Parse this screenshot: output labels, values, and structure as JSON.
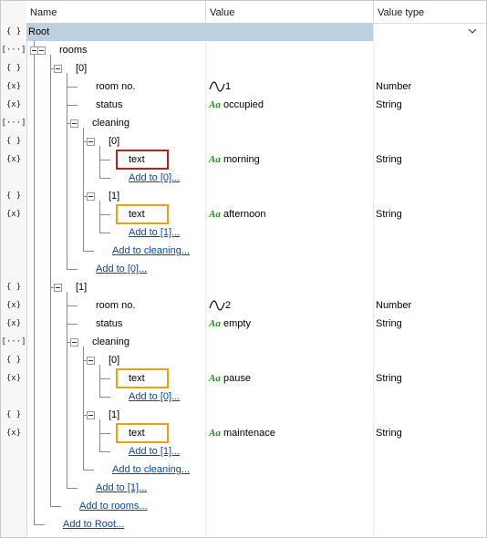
{
  "header": {
    "name": "Name",
    "value": "Value",
    "value_type": "Value type"
  },
  "colors": {
    "selected_row": "#bdd0e0",
    "highlight_red": "#b22222",
    "highlight_orange": "#f0a000",
    "link": "#0645ad",
    "string_icon": "#1a9a1a"
  },
  "rows": [
    {
      "icon": "{ }",
      "name": "Root",
      "value": "",
      "value_type": "",
      "selected": true
    },
    {
      "icon": "[···]",
      "name": "rooms",
      "value": "",
      "value_type": ""
    },
    {
      "icon": "{ }",
      "name": "[0]",
      "value": "",
      "value_type": ""
    },
    {
      "icon": "{x}",
      "name": "room no.",
      "value": "1",
      "value_icon": "number-wave-icon",
      "value_type": "Number"
    },
    {
      "icon": "{x}",
      "name": "status",
      "value": "occupied",
      "value_icon": "string-aa-icon",
      "value_type": "String"
    },
    {
      "icon": "[···]",
      "name": "cleaning",
      "value": "",
      "value_type": ""
    },
    {
      "icon": "{ }",
      "name": "[0]",
      "value": "",
      "value_type": ""
    },
    {
      "icon": "{x}",
      "name": "text",
      "value": "morning",
      "value_icon": "string-aa-icon",
      "value_type": "String"
    },
    {
      "icon": "",
      "name": "Add to [0]...",
      "value": "",
      "value_type": "",
      "link": true
    },
    {
      "icon": "{ }",
      "name": "[1]",
      "value": "",
      "value_type": ""
    },
    {
      "icon": "{x}",
      "name": "text",
      "value": "afternoon",
      "value_icon": "string-aa-icon",
      "value_type": "String"
    },
    {
      "icon": "",
      "name": "Add to [1]...",
      "value": "",
      "value_type": "",
      "link": true
    },
    {
      "icon": "",
      "name": "Add to cleaning...",
      "value": "",
      "value_type": "",
      "link": true
    },
    {
      "icon": "",
      "name": "Add to [0]...",
      "value": "",
      "value_type": "",
      "link": true
    },
    {
      "icon": "{ }",
      "name": "[1]",
      "value": "",
      "value_type": ""
    },
    {
      "icon": "{x}",
      "name": "room no.",
      "value": "2",
      "value_icon": "number-wave-icon",
      "value_type": "Number"
    },
    {
      "icon": "{x}",
      "name": "status",
      "value": "empty",
      "value_icon": "string-aa-icon",
      "value_type": "String"
    },
    {
      "icon": "[···]",
      "name": "cleaning",
      "value": "",
      "value_type": ""
    },
    {
      "icon": "{ }",
      "name": "[0]",
      "value": "",
      "value_type": ""
    },
    {
      "icon": "{x}",
      "name": "text",
      "value": "pause",
      "value_icon": "string-aa-icon",
      "value_type": "String"
    },
    {
      "icon": "",
      "name": "Add to [0]...",
      "value": "",
      "value_type": "",
      "link": true
    },
    {
      "icon": "{ }",
      "name": "[1]",
      "value": "",
      "value_type": ""
    },
    {
      "icon": "{x}",
      "name": "text",
      "value": "maintenace",
      "value_icon": "string-aa-icon",
      "value_type": "String"
    },
    {
      "icon": "",
      "name": "Add to [1]...",
      "value": "",
      "value_type": "",
      "link": true
    },
    {
      "icon": "",
      "name": "Add to cleaning...",
      "value": "",
      "value_type": "",
      "link": true
    },
    {
      "icon": "",
      "name": "Add to [1]...",
      "value": "",
      "value_type": "",
      "link": true
    },
    {
      "icon": "",
      "name": "Add to rooms...",
      "value": "",
      "value_type": "",
      "link": true
    },
    {
      "icon": "",
      "name": "Add to Root...",
      "value": "",
      "value_type": "",
      "link": true
    }
  ]
}
